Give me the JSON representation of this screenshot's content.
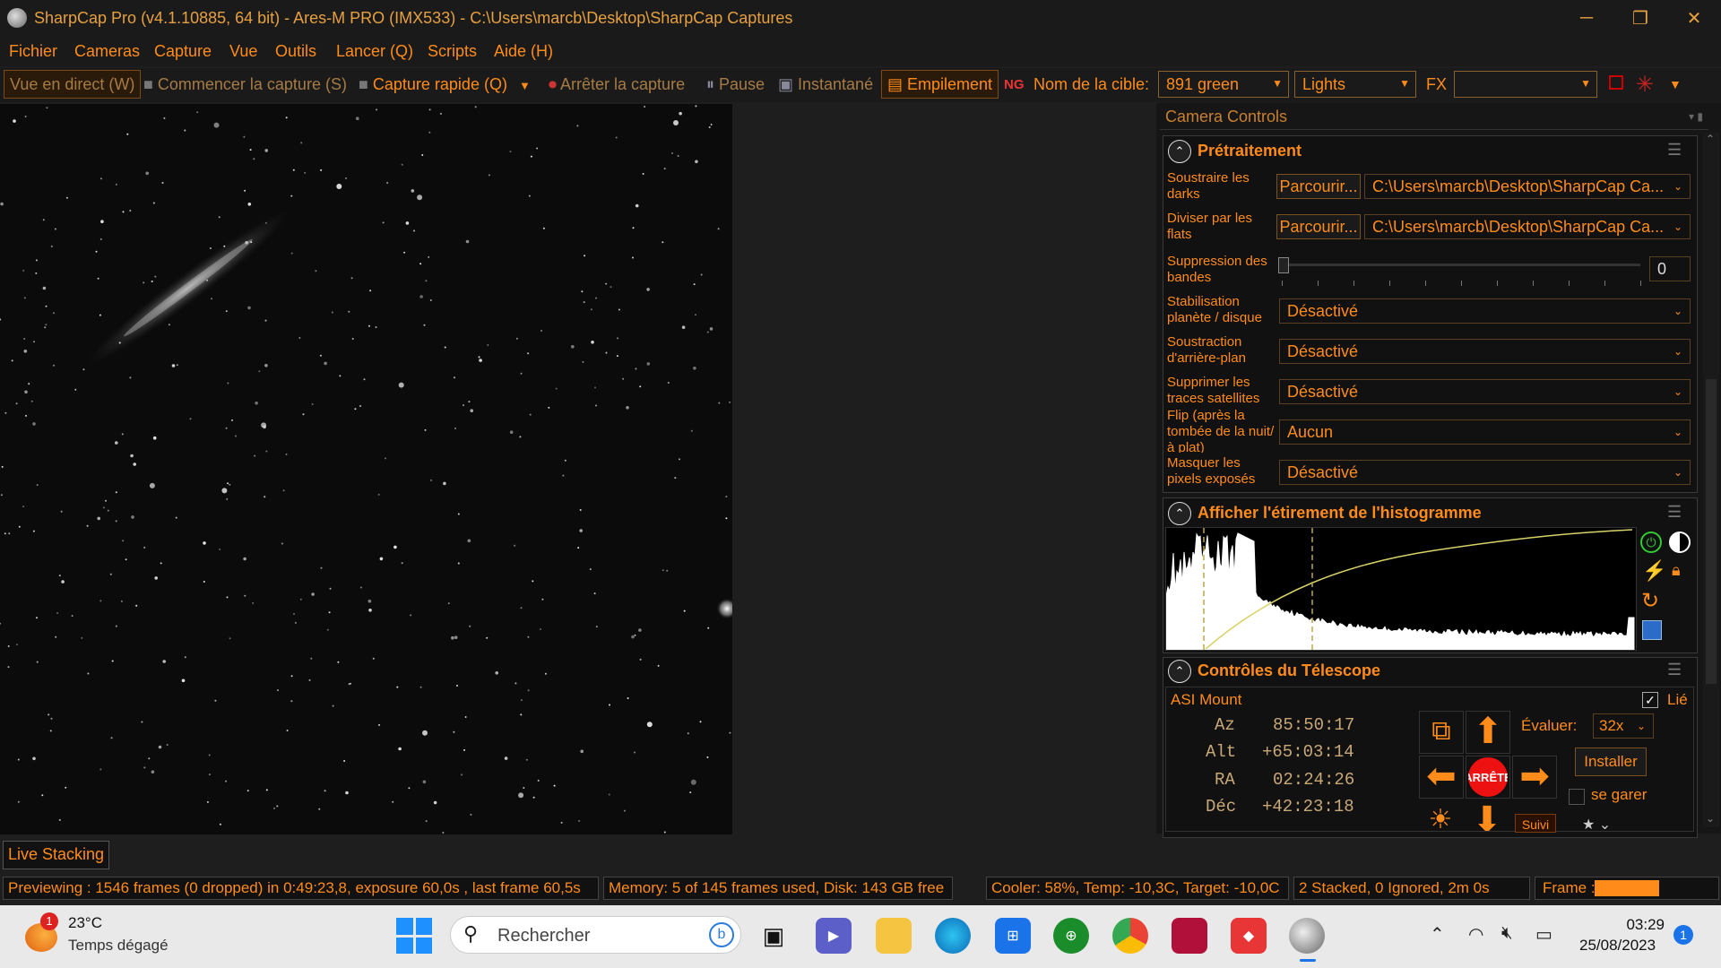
{
  "window": {
    "title": "SharpCap Pro (v4.1.10885, 64 bit) - Ares-M PRO (IMX533) - C:\\Users\\marcb\\Desktop\\SharpCap Captures",
    "minimize": "─",
    "maximize": "❐",
    "close": "✕"
  },
  "menu": [
    "Fichier",
    "Cameras",
    "Capture",
    "Vue",
    "Outils",
    "Lancer (Q)",
    "Scripts",
    "Aide (H)"
  ],
  "toolbar": {
    "live_view": "Vue en direct (W)",
    "start_capture": "Commencer la capture (S)",
    "quick_capture": "Capture rapide (Q)",
    "stop_capture": "Arrêter la capture",
    "pause": "Pause",
    "snapshot": "Instantané",
    "stacking": "Empilement",
    "target_label": "Nom de la cible:",
    "target_value": "891 green",
    "frame_type": "Lights",
    "fx_label": "FX",
    "fx_value": ""
  },
  "camera_controls": {
    "title": "Camera Controls",
    "preprocessing": {
      "title": "Prétraitement",
      "dark_label": "Soustraire les darks",
      "dark_button": "Parcourir...",
      "dark_path": "C:\\Users\\marcb\\Desktop\\SharpCap Ca...",
      "flat_label": "Diviser par les flats",
      "flat_button": "Parcourir...",
      "flat_path": "C:\\Users\\marcb\\Desktop\\SharpCap Ca...",
      "banding_label": "Suppression des bandes",
      "banding_value": "0",
      "banding_level": 0,
      "stab_label": "Stabilisation planète / disque",
      "stab_value": "Désactivé",
      "bg_label": "Soustraction d'arrière-plan",
      "bg_value": "Désactivé",
      "sat_label": "Supprimer les traces satellites",
      "sat_value": "Désactivé",
      "flip_label": "Flip (après la tombée de la nuit/à plat)",
      "flip_value": "Aucun",
      "mask_label": "Masquer les pixels exposés",
      "mask_value": "Désactivé"
    },
    "histogram": {
      "title": "Afficher l'étirement de l'histogramme"
    },
    "telescope": {
      "title": "Contrôles du Télescope",
      "mount": "ASI Mount",
      "linked_label": "Lié",
      "linked": true,
      "az_label": "Az",
      "az_value": "85:50:17",
      "alt_label": "Alt",
      "alt_value": "+65:03:14",
      "ra_label": "RA",
      "ra_value": "02:24:26",
      "dec_label": "Déc",
      "dec_value": "+42:23:18",
      "stop_label": "ARRÊTE",
      "rate_label": "Évaluer:",
      "rate_value": "32x",
      "setup_button": "Installer",
      "park_label": "se garer",
      "track_label": "Suivi"
    }
  },
  "live_stacking_tab": "Live Stacking",
  "status": {
    "preview": "Previewing : 1546 frames (0 dropped) in 0:49:23,8, exposure 60,0s , last frame 60,5s",
    "memory": "Memory: 5 of 145 frames used, Disk: 143 GB free",
    "cooler": "Cooler: 58%, Temp: -10,3C, Target: -10,0C",
    "stacked": "2 Stacked, 0 Ignored, 2m 0s",
    "frame_label": "Frame :",
    "frame_progress": 0.55
  },
  "taskbar": {
    "weather_temp": "23°C",
    "weather_desc": "Temps dégagé",
    "weather_badge": "1",
    "search_placeholder": "Rechercher",
    "time": "03:29",
    "date": "25/08/2023",
    "notif_count": "1"
  },
  "colors": {
    "accent": "#ff8c1a",
    "background": "#1e1e1e",
    "stop_red": "#e11",
    "taskbar": "#e9e9ea"
  }
}
